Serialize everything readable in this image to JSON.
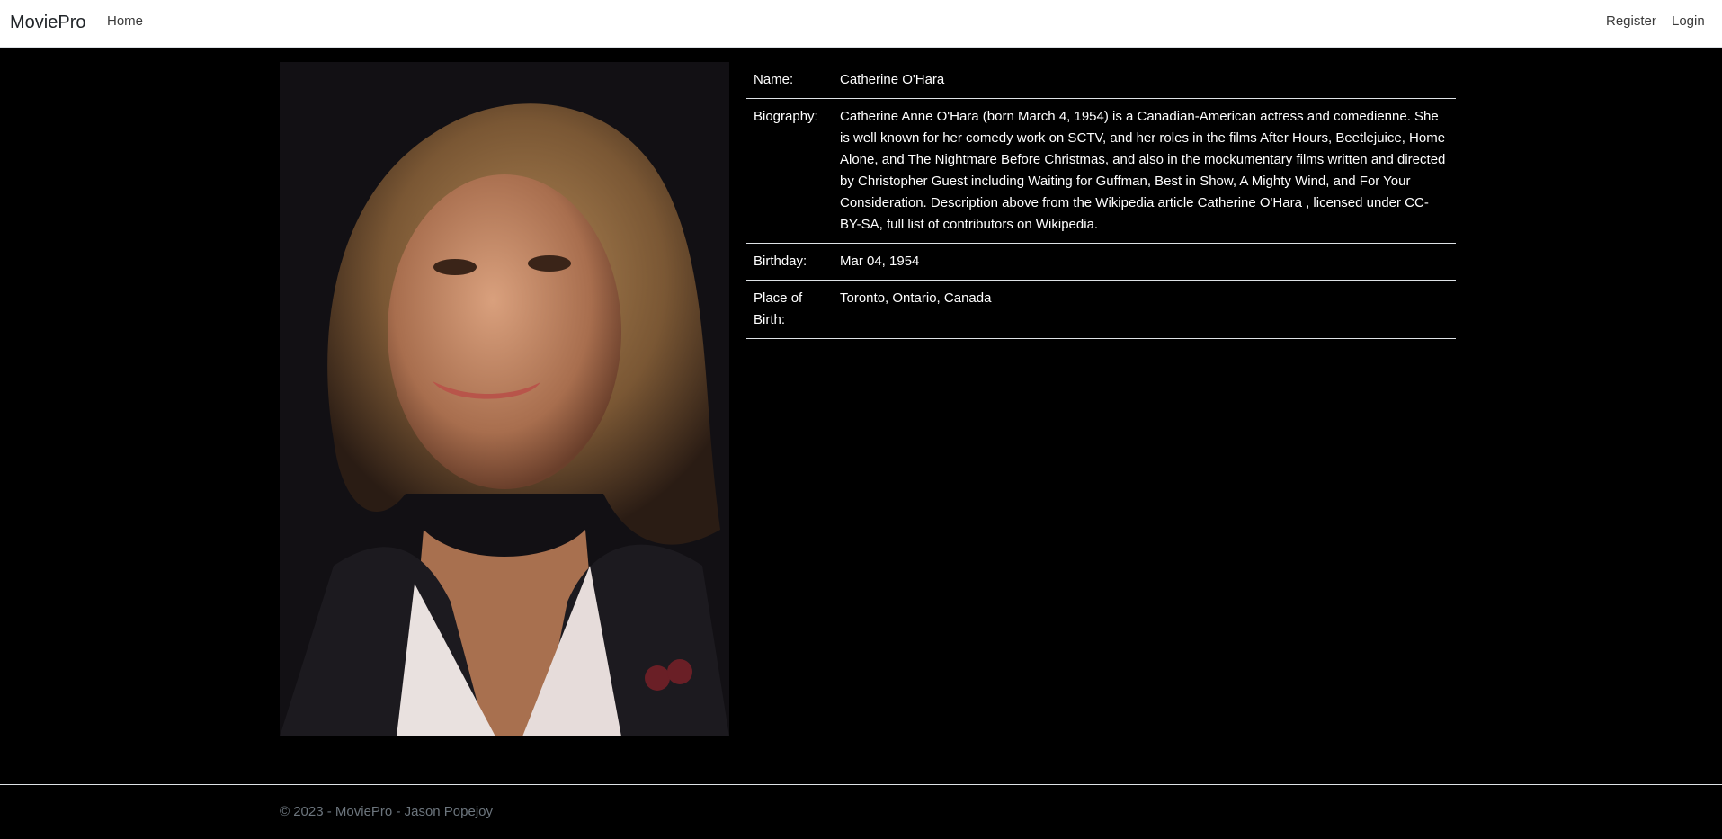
{
  "navbar": {
    "brand": "MoviePro",
    "home": "Home",
    "register": "Register",
    "login": "Login"
  },
  "person": {
    "photo_alt": "Catherine O'Hara",
    "rows": [
      {
        "label": "Name:",
        "value": "Catherine O'Hara"
      },
      {
        "label": "Biography:",
        "value": "Catherine Anne O'Hara (born March 4, 1954) is a Canadian-American actress and comedienne. She is well known for her comedy work on SCTV, and her roles in the films After Hours, Beetlejuice, Home Alone, and The Nightmare Before Christmas, and also in the mockumentary films written and directed by Christopher Guest including Waiting for Guffman, Best in Show, A Mighty Wind, and For Your Consideration. Description above from the Wikipedia article Catherine O'Hara , licensed under CC-BY-SA, full list of contributors on Wikipedia."
      },
      {
        "label": "Birthday:",
        "value": "Mar 04, 1954"
      },
      {
        "label": "Place of Birth:",
        "value": "Toronto, Ontario, Canada"
      }
    ]
  },
  "footer": {
    "text": "© 2023 - MoviePro - Jason Popejoy"
  }
}
